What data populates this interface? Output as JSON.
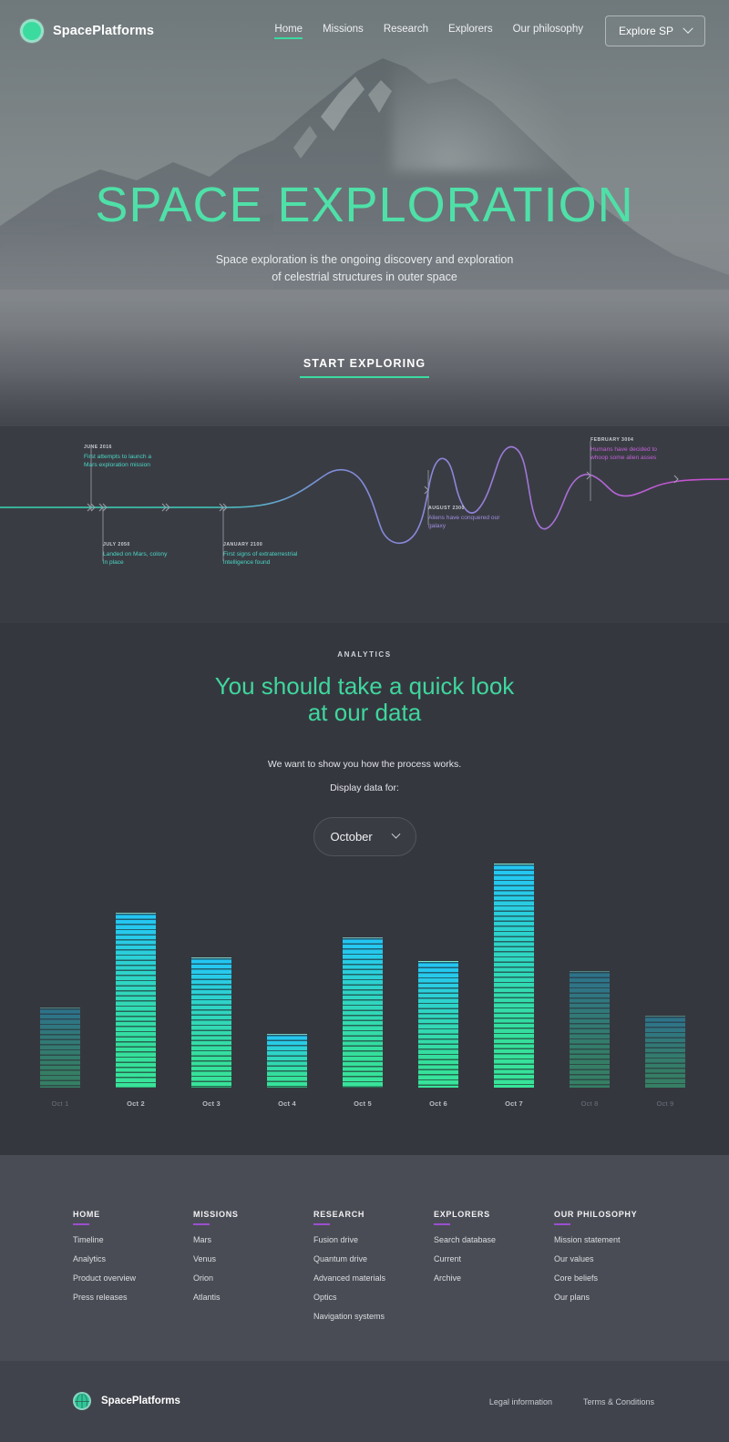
{
  "header": {
    "brand": "SpacePlatforms",
    "logo_icon": "circle-logo-icon",
    "nav": [
      {
        "label": "Home",
        "active": true
      },
      {
        "label": "Missions",
        "active": false
      },
      {
        "label": "Research",
        "active": false
      },
      {
        "label": "Explorers",
        "active": false
      },
      {
        "label": "Our philosophy",
        "active": false
      }
    ],
    "explore_button": "Explore SP",
    "explore_icon": "chevron-down-icon"
  },
  "hero": {
    "title": "SPACE EXPLORATION",
    "subtitle_line1": "Space exploration is the ongoing discovery and exploration",
    "subtitle_line2": "of celestrial structures in outer space",
    "cta": "START EXPLORING",
    "accent_color": "#3bdba0"
  },
  "timeline": {
    "events": [
      {
        "date": "JUNE 2016",
        "text_line1": "First attempts to launch a",
        "text_line2": "Mars exploration mission",
        "color": "#4ad6c4",
        "position": "above"
      },
      {
        "date": "JULY 2050",
        "text_line1": "Landed on Mars, colony",
        "text_line2": "in place",
        "color": "#4ad6c4",
        "position": "below"
      },
      {
        "date": "JANUARY 2100",
        "text_line1": "First signs of extraterrestrial",
        "text_line2": "intelligence found",
        "color": "#4ad6c4",
        "position": "below"
      },
      {
        "date": "AUGUST 2300",
        "text_line1": "Aliens have conquered our",
        "text_line2": "galaxy",
        "color": "#9d8fe0",
        "position": "below"
      },
      {
        "date": "FEBRUARY 3004",
        "text_line1": "Humans have decided to",
        "text_line2": "whoop some alien asses",
        "color": "#c262d8",
        "position": "above"
      }
    ],
    "curve_start_color": "#34d9b0",
    "curve_mid_color": "#8d86d8",
    "curve_end_color": "#cf4ad0"
  },
  "analytics": {
    "eyebrow": "ANALYTICS",
    "title_line1": "You should take a quick look",
    "title_line2": "at our data",
    "description": "We want to show you how the process works.",
    "display_label": "Display data for:",
    "selected_month": "October",
    "select_icon": "chevron-down-icon",
    "months": [
      "October"
    ]
  },
  "chart_data": {
    "type": "bar",
    "title": "You should take a quick look at our data",
    "xlabel": "",
    "ylabel": "",
    "grid": false,
    "categories": [
      "Oct 1",
      "Oct 2",
      "Oct 3",
      "Oct 4",
      "Oct 5",
      "Oct 6",
      "Oct 7",
      "Oct 8",
      "Oct 9"
    ],
    "values": [
      91,
      198,
      147,
      61,
      170,
      143,
      254,
      132,
      81
    ],
    "ylim": [
      0,
      270
    ],
    "dimmed": [
      true,
      false,
      false,
      false,
      false,
      false,
      false,
      true,
      true
    ],
    "bar_gradient_top": "#22c5f5",
    "bar_gradient_bottom": "#38e49a"
  },
  "footer": {
    "columns": [
      {
        "heading": "HOME",
        "links": [
          "Timeline",
          "Analytics",
          "Product overview",
          "Press releases"
        ]
      },
      {
        "heading": "MISSIONS",
        "links": [
          "Mars",
          "Venus",
          "Orion",
          "Atlantis"
        ]
      },
      {
        "heading": "RESEARCH",
        "links": [
          "Fusion drive",
          "Quantum drive",
          "Advanced materials",
          "Optics",
          "Navigation systems"
        ]
      },
      {
        "heading": "EXPLORERS",
        "links": [
          "Search database",
          "Current",
          "Archive"
        ]
      },
      {
        "heading": "OUR PHILOSOPHY",
        "links": [
          "Mission statement",
          "Our values",
          "Core beliefs",
          "Our plans"
        ]
      }
    ],
    "underline_color": "#9b4fd0",
    "bottom": {
      "brand": "SpacePlatforms",
      "logo_icon": "globe-icon",
      "links": [
        "Legal information",
        "Terms & Conditions"
      ]
    }
  }
}
